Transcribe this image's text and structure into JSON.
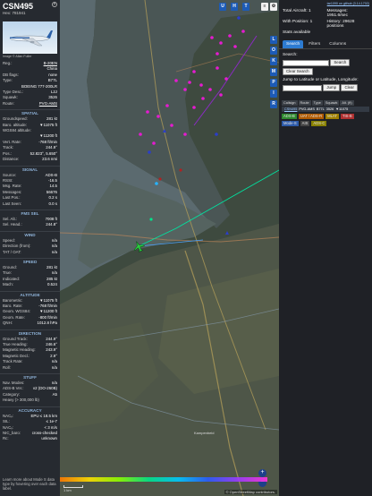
{
  "info": {
    "callsign": "CSN495",
    "hex": "Hex: 781941",
    "photo_credit": "Image © Allan Fuller",
    "basic": [
      {
        "k": "Reg.:",
        "v": "B-20EN",
        "link": true
      },
      {
        "k": "",
        "v": "China"
      },
      {
        "k": "DB flags:",
        "v": "none"
      },
      {
        "k": "Type:",
        "v": "B77L"
      },
      {
        "k": "",
        "v": "BOEING 777-200LR"
      },
      {
        "k": "Type Desc.:",
        "v": "L2J"
      },
      {
        "k": "Squawk:",
        "v": "3526"
      },
      {
        "k": "Route:",
        "v": "PVG-AMS",
        "link": true
      }
    ],
    "sections": [
      {
        "title": "SPATIAL",
        "rows": [
          {
            "k": "Groundspeed:",
            "v": "281 kt"
          },
          {
            "k": "Baro. altitude:",
            "v": "▼11075 ft"
          },
          {
            "k": "WGS84 altitude:",
            "v": ""
          },
          {
            "k": "",
            "v": "▼11200 ft"
          },
          {
            "k": "Vert. Rate:",
            "v": "-768 ft/min"
          },
          {
            "k": "Track:",
            "v": "244.9°"
          },
          {
            "k": "Pos.:",
            "v": "52.823°, 5.650°"
          },
          {
            "k": "Distance:",
            "v": "23.6 nmi"
          }
        ]
      },
      {
        "title": "SIGNAL",
        "rows": [
          {
            "k": "Source:",
            "v": "ADS-B"
          },
          {
            "k": "RSSI:",
            "v": "-16.5"
          },
          {
            "k": "Msg. Rate:",
            "v": "14.5"
          },
          {
            "k": "Messages:",
            "v": "56676"
          },
          {
            "k": "Last Pos.:",
            "v": "0.2 s"
          },
          {
            "k": "Last Seen:",
            "v": "0.0 s"
          }
        ]
      },
      {
        "title": "FMS SEL",
        "rows": [
          {
            "k": "Sel. Alt.:",
            "v": "7008 ft"
          },
          {
            "k": "Sel. Head.:",
            "v": "244.8°"
          }
        ]
      },
      {
        "title": "WIND",
        "rows": [
          {
            "k": "Speed:",
            "v": "n/a"
          },
          {
            "k": "Direction (from):",
            "v": "n/a"
          },
          {
            "k": "TAT / OAT:",
            "v": "n/a"
          }
        ]
      },
      {
        "title": "SPEED",
        "rows": [
          {
            "k": "Ground:",
            "v": "281 kt"
          },
          {
            "k": "True:",
            "v": "n/a"
          },
          {
            "k": "Indicated:",
            "v": "285 kt"
          },
          {
            "k": "Mach:",
            "v": "0.524"
          }
        ]
      },
      {
        "title": "ALTITUDE",
        "rows": [
          {
            "k": "Barometric:",
            "v": "▼11075 ft"
          },
          {
            "k": "Baro. Rate:",
            "v": "-768 ft/min"
          },
          {
            "k": "Geom. WGS84:",
            "v": "▼11200 ft"
          },
          {
            "k": "Geom. Rate:",
            "v": "-800 ft/min"
          },
          {
            "k": "QNH:",
            "v": "1012.8 hPa"
          }
        ]
      },
      {
        "title": "DIRECTION",
        "rows": [
          {
            "k": "Ground Track:",
            "v": "244.9°"
          },
          {
            "k": "True Heading:",
            "v": "246.6°"
          },
          {
            "k": "Magnetic Heading:",
            "v": "243.9°"
          },
          {
            "k": "Magnetic Decl.:",
            "v": "2.9°"
          },
          {
            "k": "Track Rate:",
            "v": "n/a"
          },
          {
            "k": "Roll:",
            "v": "n/a"
          }
        ]
      },
      {
        "title": "STUFF",
        "rows": [
          {
            "k": "Nav. Modes:",
            "v": "n/a"
          },
          {
            "k": "ADS-B Ver.:",
            "v": "v2 (DO-260B)"
          },
          {
            "k": "Category:",
            "v": "A5"
          },
          {
            "k": "Heavy (> 300,000 lb)",
            "v": ""
          }
        ]
      },
      {
        "title": "ACCURACY",
        "rows": [
          {
            "k": "NACₚ:",
            "v": "EPU ≤ 18.5 km"
          },
          {
            "k": "SIL:",
            "v": "≤ 1e-7"
          },
          {
            "k": "NACᵥ:",
            "v": "< 3 m/s"
          },
          {
            "k": "NIC_baro:",
            "v": "cross-checked"
          },
          {
            "k": "Rc:",
            "v": "unknown"
          }
        ]
      }
    ],
    "footer": "Learn more about Mode S data type by hovering over each data label."
  },
  "map": {
    "buttons": [
      "U",
      "H",
      "T"
    ],
    "side_buttons": [
      "L",
      "O",
      "K",
      "M",
      "P",
      "I",
      "R"
    ],
    "scale_label": "1 km",
    "attribution": "© OpenStreetMap contributors.",
    "zoom_in": "+",
    "zoom_out": "−"
  },
  "right": {
    "top_link": "tar1090 on github (3.14.1702)",
    "stats": [
      "Total Aircraft: 1",
      "Messages: 1951.6/sec",
      "With Position: 1",
      "History: 29628 positions",
      "Stats available"
    ],
    "tabs": [
      "Search",
      "Filters",
      "Columns"
    ],
    "search_label": "Search:",
    "search_button": "Search",
    "clear_search": "Clear Search",
    "jump_label": "Jump to Latitude or Latitude, Longitude:",
    "jump_button": "Jump",
    "clear_button": "Clear",
    "table_headers": [
      "Callsign",
      "Route",
      "Type",
      "Squawk",
      "Alt. (ft)"
    ],
    "table_row": [
      "CSN495",
      "PVG-AMS",
      "B77L",
      "3526",
      "▼11075"
    ],
    "sources": [
      {
        "label": "ADS-B",
        "color": "#2f8a2f"
      },
      {
        "label": "UAT / ADS-R",
        "color": "#b05a00"
      },
      {
        "label": "MLAT",
        "color": "#a08000"
      },
      {
        "label": "TIS-B",
        "color": "#b03030"
      },
      {
        "label": "Mode-S",
        "color": "#2d5aa8"
      },
      {
        "label": "AIS",
        "color": "#444"
      },
      {
        "label": "ADS-C",
        "color": "#888000"
      }
    ]
  }
}
